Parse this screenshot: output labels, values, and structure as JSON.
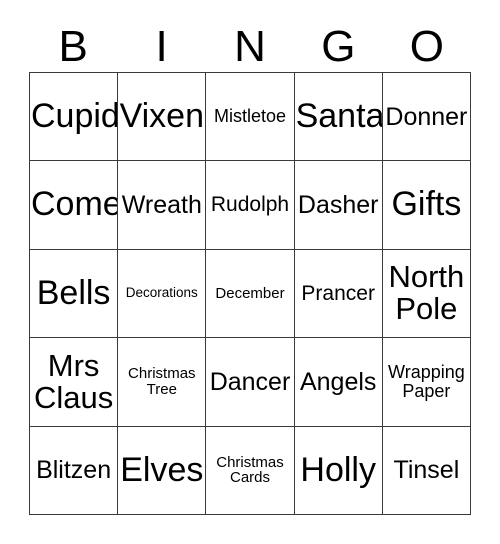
{
  "card": {
    "header_letters": [
      "B",
      "I",
      "N",
      "G",
      "O"
    ],
    "rows": [
      [
        {
          "label": "Cupid",
          "size": "xxl"
        },
        {
          "label": "Vixen",
          "size": "xxl"
        },
        {
          "label": "Mistletoe",
          "size": "xs"
        },
        {
          "label": "Santa",
          "size": "xxl"
        },
        {
          "label": "Donner",
          "size": "m"
        }
      ],
      [
        {
          "label": "Come",
          "size": "xxl"
        },
        {
          "label": "Wreath",
          "size": "m"
        },
        {
          "label": "Rudolph",
          "size": "s"
        },
        {
          "label": "Dasher",
          "size": "m"
        },
        {
          "label": "Gifts",
          "size": "xxl"
        }
      ],
      [
        {
          "label": "Bells",
          "size": "xxl"
        },
        {
          "label": "Decorations",
          "size": "min"
        },
        {
          "label": "December",
          "size": "xxs"
        },
        {
          "label": "Prancer",
          "size": "s"
        },
        {
          "label": "North\nPole",
          "size": "xl"
        }
      ],
      [
        {
          "label": "Mrs\nClaus",
          "size": "xl"
        },
        {
          "label": "Christmas\nTree",
          "size": "xxs"
        },
        {
          "label": "Dancer",
          "size": "m"
        },
        {
          "label": "Angels",
          "size": "m"
        },
        {
          "label": "Wrapping\nPaper",
          "size": "xs"
        }
      ],
      [
        {
          "label": "Blitzen",
          "size": "m"
        },
        {
          "label": "Elves",
          "size": "xxl"
        },
        {
          "label": "Christmas\nCards",
          "size": "xxs"
        },
        {
          "label": "Holly",
          "size": "xxl"
        },
        {
          "label": "Tinsel",
          "size": "m"
        }
      ]
    ]
  }
}
